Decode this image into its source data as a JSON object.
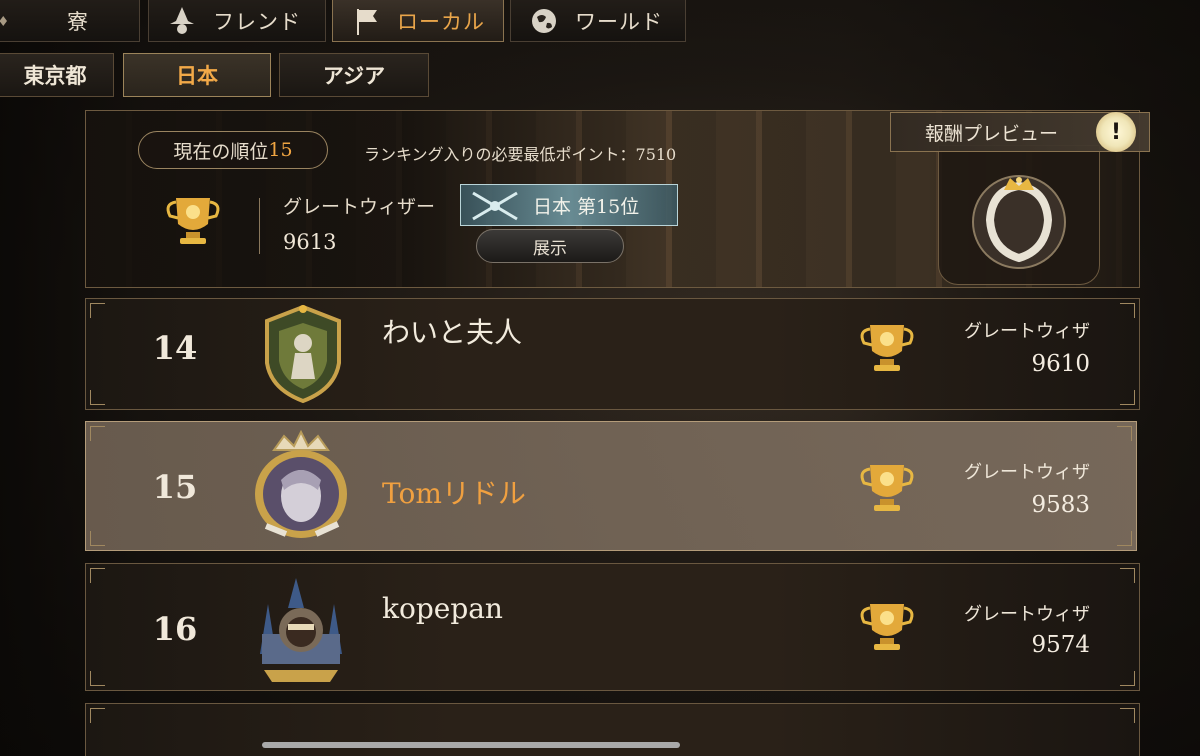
{
  "tabs": [
    {
      "label": "寮",
      "icon": "dorm-icon"
    },
    {
      "label": "フレンド",
      "icon": "wizard-hat-icon"
    },
    {
      "label": "ローカル",
      "icon": "flag-icon",
      "active": true
    },
    {
      "label": "ワールド",
      "icon": "globe-icon"
    }
  ],
  "region_tabs": [
    {
      "label": "東京都"
    },
    {
      "label": "日本",
      "active": true
    },
    {
      "label": "アジア"
    }
  ],
  "my_rank": {
    "rank_label": "現在の順位",
    "rank_value": "15",
    "min_points_text": "ランキング入りの必要最低ポイント：7510",
    "tier": "グレートウィザー",
    "score": "9613",
    "national_badge": "日本 第15位",
    "show_button": "展示",
    "reward_preview": "報酬プレビュー",
    "alert": "!"
  },
  "rows": [
    {
      "rank": "14",
      "name": "わいと夫人",
      "tier": "グレートウィザ",
      "score": "9610",
      "highlight": false
    },
    {
      "rank": "15",
      "name": "Tomリドル",
      "tier": "グレートウィザ",
      "score": "9583",
      "highlight": true
    },
    {
      "rank": "16",
      "name": "kopepan",
      "tier": "グレートウィザ",
      "score": "9574",
      "highlight": false
    }
  ],
  "colors": {
    "accent": "#f0a040",
    "gold": "#e7b742",
    "panel": "#2a2118"
  }
}
